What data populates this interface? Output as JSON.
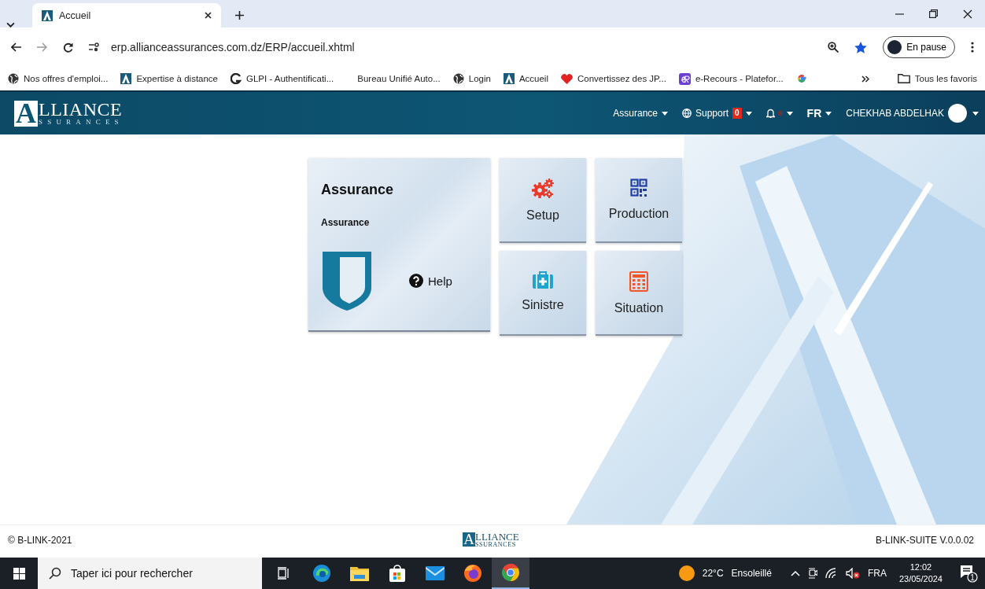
{
  "browser": {
    "tabs": [
      {
        "title": "Accueil",
        "selected": true
      }
    ],
    "url": "erp.allianceassurances.com.dz/ERP/accueil.xhtml",
    "profile": "En pause",
    "bookmarks": [
      {
        "label": "Nos offres d'emploi...",
        "kind": "globe"
      },
      {
        "label": "Expertise à distance",
        "kind": "alliance"
      },
      {
        "label": "GLPI - Authentificati...",
        "kind": "glpi"
      },
      {
        "label": "Bureau Unifié Auto...",
        "kind": "plain"
      },
      {
        "label": "Login",
        "kind": "globe"
      },
      {
        "label": "Accueil",
        "kind": "alliance"
      },
      {
        "label": "Convertissez des JP...",
        "kind": "heart"
      },
      {
        "label": "e-Recours - Platefor...",
        "kind": "erecours"
      },
      {
        "kind": "google"
      }
    ],
    "all_bookmarks": "Tous les favoris"
  },
  "header": {
    "logo": {
      "letter": "A",
      "top": "LLIANCE",
      "bottom": "SSURANCES"
    },
    "menus": [
      {
        "kind": "menu",
        "label": "Assurance"
      },
      {
        "kind": "support",
        "label": "Support",
        "badge": "0"
      },
      {
        "kind": "bell",
        "badge": "0"
      },
      {
        "kind": "lang",
        "label": "FR"
      },
      {
        "kind": "user",
        "label": "CHEKHAB ABDELHAK"
      }
    ]
  },
  "module": {
    "title": "Assurance",
    "subtitle": "Assurance",
    "help": "Help"
  },
  "tiles": [
    {
      "label": "Setup",
      "kind": "gears",
      "color": "#e8392b"
    },
    {
      "label": "Production",
      "kind": "qr",
      "color": "#1f3fa6"
    },
    {
      "label": "Sinistre",
      "kind": "medkit",
      "color": "#1fa3cf"
    },
    {
      "label": "Situation",
      "kind": "calculator",
      "color": "#f0562a"
    }
  ],
  "footer": {
    "copyright": "© B-LINK-2021",
    "logo": {
      "letter": "A",
      "top": "LLIANCE",
      "bottom": "SSURANCES"
    },
    "version": "B-LINK-SUITE V.0.0.02"
  },
  "taskbar": {
    "search_placeholder": "Taper ici pour rechercher",
    "apps": [
      {
        "kind": "taskview",
        "selected": false
      },
      {
        "kind": "edge",
        "selected": false
      },
      {
        "kind": "files",
        "selected": false
      },
      {
        "kind": "store",
        "selected": false
      },
      {
        "kind": "mail",
        "selected": false
      },
      {
        "kind": "firefox",
        "selected": false
      },
      {
        "kind": "chrome",
        "selected": true
      }
    ],
    "weather": {
      "temperature": "22°C",
      "condition": "Ensoleillé"
    },
    "language": "FRA",
    "time": "12:02",
    "date": "23/05/2024",
    "notifications": "1"
  }
}
